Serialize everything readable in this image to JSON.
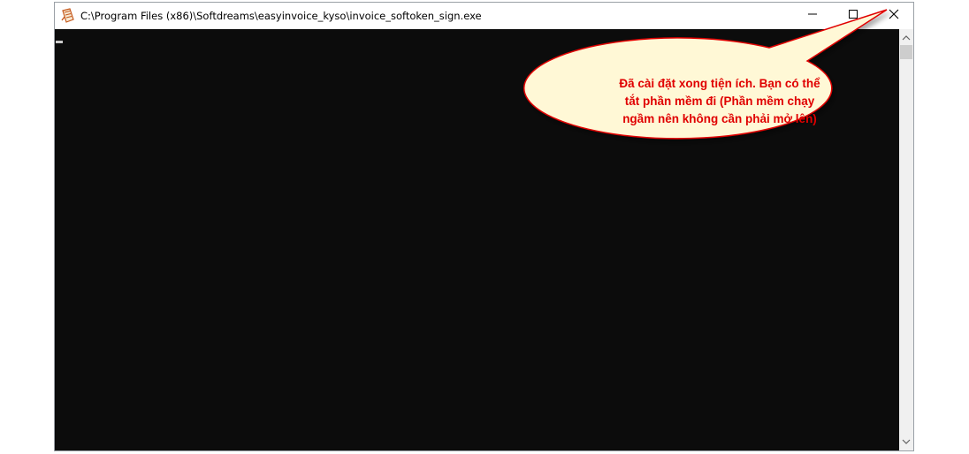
{
  "window": {
    "title": "C:\\Program Files (x86)\\Softdreams\\easyinvoice_kyso\\invoice_softoken_sign.exe",
    "icon": "console-app-icon",
    "controls": {
      "minimize": "minimize-icon",
      "maximize": "maximize-icon",
      "close": "close-icon"
    }
  },
  "console": {
    "background": "#0c0c0c",
    "cursor_color": "#cccccc"
  },
  "scrollbar": {
    "up_icon": "chevron-up-icon",
    "down_icon": "chevron-down-icon"
  },
  "callout": {
    "line1": "Đã cài đặt xong tiện ích. Bạn có thể",
    "line2": "tắt phần mềm đi (Phần mềm chạy",
    "line3": "ngầm nên không cần phải mở lên)",
    "text_color": "#e00000",
    "fill_color": "#fff8d6",
    "border_color": "#e00000"
  }
}
